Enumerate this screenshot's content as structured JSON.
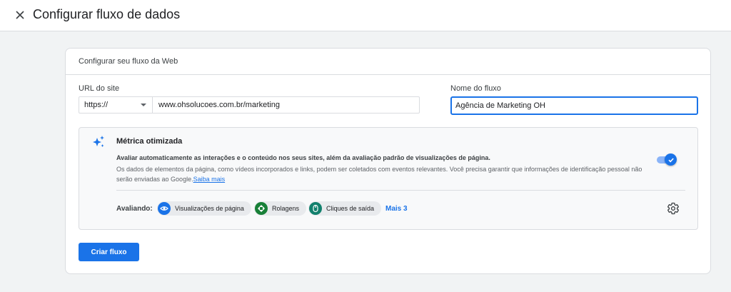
{
  "page": {
    "title": "Configurar fluxo de dados"
  },
  "card": {
    "header": "Configurar seu fluxo da Web"
  },
  "url_field": {
    "label": "URL do site",
    "protocol": "https://",
    "value": "www.ohsolucoes.com.br/marketing"
  },
  "name_field": {
    "label": "Nome do fluxo",
    "value": "Agência de Marketing OH"
  },
  "metrics": {
    "title": "Métrica otimizada",
    "description": "Avaliar automaticamente as interações e o conteúdo nos seus sites, além da avaliação padrão de visualizações de página.",
    "detail": "Os dados de elementos da página, como vídeos incorporados e links, podem ser coletados com eventos relevantes. Você precisa garantir que informações de identificação pessoal não serão enviadas ao Google.",
    "learn_more": "Saiba mais",
    "enabled": true,
    "evaluating_label": "Avaliando:",
    "events": [
      {
        "label": "Visualizações de página",
        "icon": "eye-icon",
        "color": "#1a73e8"
      },
      {
        "label": "Rolagens",
        "icon": "crosshair-icon",
        "color": "#188038"
      },
      {
        "label": "Cliques de saída",
        "icon": "mouse-icon",
        "color": "#12806d"
      }
    ],
    "more": "Mais 3"
  },
  "actions": {
    "create": "Criar fluxo"
  },
  "colors": {
    "accent": "#1a73e8",
    "background": "#f1f3f4"
  }
}
